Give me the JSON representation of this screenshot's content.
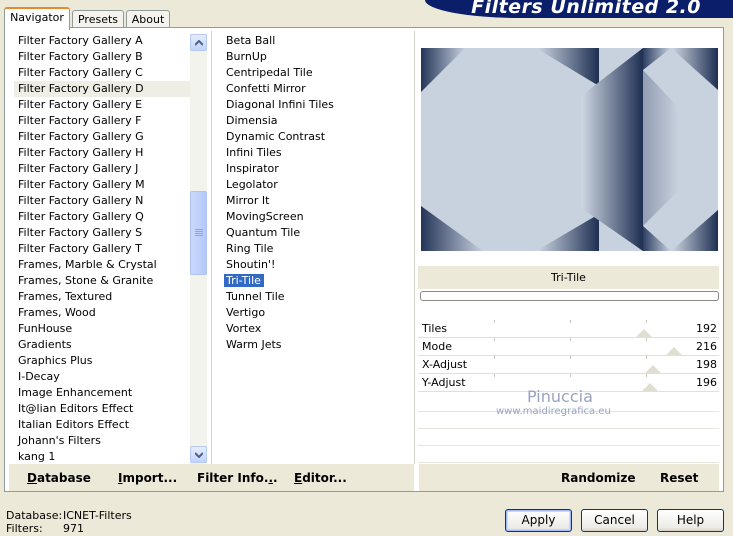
{
  "tabs": [
    {
      "label": "Navigator"
    },
    {
      "label": "Presets"
    },
    {
      "label": "About"
    }
  ],
  "banner": {
    "title": "Filters Unlimited 2.0"
  },
  "categories": [
    "Filter Factory Gallery A",
    "Filter Factory Gallery B",
    "Filter Factory Gallery C",
    "Filter Factory Gallery D",
    "Filter Factory Gallery E",
    "Filter Factory Gallery F",
    "Filter Factory Gallery G",
    "Filter Factory Gallery H",
    "Filter Factory Gallery J",
    "Filter Factory Gallery M",
    "Filter Factory Gallery N",
    "Filter Factory Gallery Q",
    "Filter Factory Gallery S",
    "Filter Factory Gallery T",
    "Frames, Marble & Crystal",
    "Frames, Stone & Granite",
    "Frames, Textured",
    "Frames, Wood",
    "FunHouse",
    "Gradients",
    "Graphics Plus",
    "I-Decay",
    "Image Enhancement",
    "It@lian Editors Effect",
    "Italian Editors Effect",
    "Johann's Filters",
    "kang 1"
  ],
  "selected_category": "Filter Factory Gallery D",
  "filters": [
    "Beta Ball",
    "BurnUp",
    "Centripedal Tile",
    "Confetti Mirror",
    "Diagonal Infini Tiles",
    "Dimensia",
    "Dynamic Contrast",
    "Infini Tiles",
    "Inspirator",
    "Legolator",
    "Mirror It",
    "MovingScreen",
    "Quantum Tile",
    "Ring Tile",
    "Shoutin'!",
    "Tri-Tile",
    "Tunnel Tile",
    "Vertigo",
    "Vortex",
    "Warm Jets"
  ],
  "selected_filter": "Tri-Tile",
  "filter_name": "Tri-Tile",
  "parameters": [
    {
      "name": "Tiles",
      "value": "192",
      "level": 0.75
    },
    {
      "name": "Mode",
      "value": "216",
      "level": 0.85
    },
    {
      "name": "X-Adjust",
      "value": "198",
      "level": 0.78
    },
    {
      "name": "Y-Adjust",
      "value": "196",
      "level": 0.77
    }
  ],
  "left_buttons": {
    "database": "Database",
    "import": "Import...",
    "filter_info": "Filter Info...",
    "editor": "Editor..."
  },
  "right_buttons": {
    "randomize": "Randomize",
    "reset": "Reset"
  },
  "watermark": {
    "name": "Pinuccia",
    "site": "www.maidiregrafica.eu"
  },
  "status": {
    "database_label": "Database:",
    "database_value": "ICNET-Filters",
    "filters_label": "Filters:",
    "filters_value": "971"
  },
  "dialog_buttons": {
    "apply": "Apply",
    "cancel": "Cancel",
    "help": "Help"
  },
  "colors": {
    "selection": "#316AC5",
    "banner": "#0A1E6A",
    "preview_light": "#C5CEDC",
    "preview_dark": "#223559"
  }
}
